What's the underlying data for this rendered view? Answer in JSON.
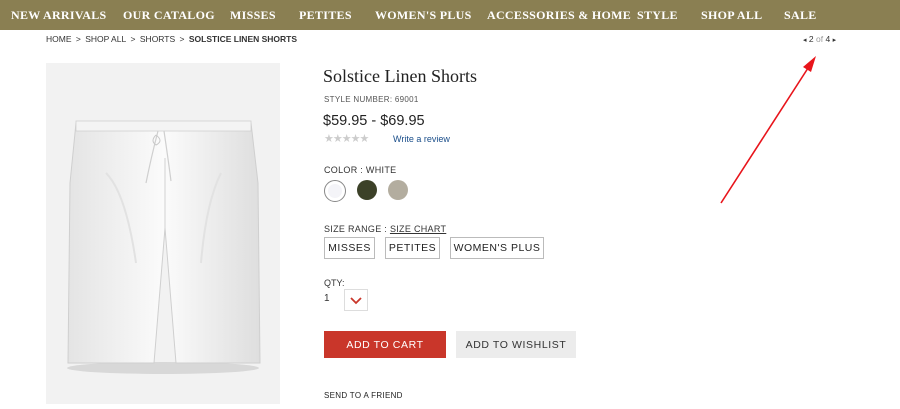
{
  "nav": [
    {
      "label": "NEW ARRIVALS"
    },
    {
      "label": "OUR CATALOG"
    },
    {
      "label": "MISSES"
    },
    {
      "label": "PETITES"
    },
    {
      "label": "WOMEN'S PLUS"
    },
    {
      "label": "ACCESSORIES & HOME"
    },
    {
      "label": "STYLE"
    },
    {
      "label": "SHOP ALL"
    },
    {
      "label": "SALE"
    }
  ],
  "breadcrumb": {
    "home": "HOME",
    "sep1": ">",
    "shop_all": "SHOP ALL",
    "sep2": ">",
    "shorts": "SHORTS",
    "sep3": ">",
    "current": "SOLSTICE LINEN SHORTS"
  },
  "pager": {
    "prev": "◂",
    "current": "2",
    "of": "of",
    "total": "4",
    "next": "▸"
  },
  "product": {
    "title": "Solstice Linen Shorts",
    "style_number": "STYLE NUMBER: 69001",
    "price": "$59.95 - $69.95",
    "stars": "★★★★★",
    "rating_stars": 0,
    "write_review": "Write a review",
    "color_label": "COLOR :",
    "color_value": "WHITE",
    "colors": [
      "#ffffff",
      "#3c4128",
      "#b3ad9f"
    ],
    "size_range_label": "SIZE RANGE :",
    "size_chart": "SIZE CHART",
    "sizes": [
      "MISSES",
      "PETITES",
      "WOMEN'S PLUS"
    ],
    "qty_label": "QTY:",
    "qty_value": "1",
    "add_to_cart": "ADD TO CART",
    "add_to_wishlist": "ADD TO WISHLIST",
    "send_to_friend": "SEND TO A FRIEND"
  },
  "colors": {
    "nav_bg": "#8a7f52",
    "cart_bg": "#c9362a",
    "annotation": "#e8141b"
  }
}
